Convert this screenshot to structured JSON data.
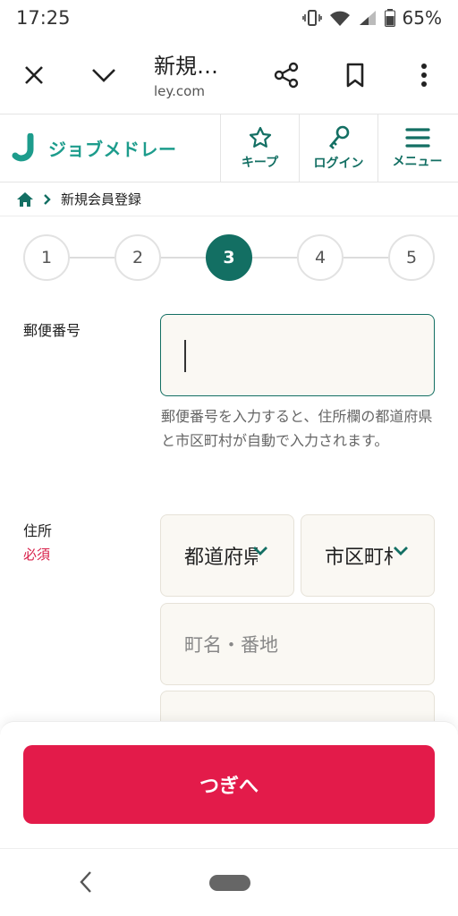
{
  "status_bar": {
    "time": "17:25",
    "battery": "65%"
  },
  "browser": {
    "title": "新規…",
    "url": "ley.com"
  },
  "site": {
    "logo_text": "ジョブメドレー",
    "buttons": [
      {
        "label": "キープ",
        "icon": "star-icon"
      },
      {
        "label": "ログイン",
        "icon": "key-icon"
      },
      {
        "label": "メニュー",
        "icon": "menu-icon"
      }
    ]
  },
  "breadcrumb": {
    "current": "新規会員登録"
  },
  "stepper": {
    "steps": [
      "1",
      "2",
      "3",
      "4",
      "5"
    ],
    "active_step": 3
  },
  "form": {
    "postal": {
      "label": "郵便番号",
      "value": "",
      "help": "郵便番号を入力すると、住所欄の都道府県と市区町村が自動で入力されます。"
    },
    "address": {
      "label": "住所",
      "required": "必須",
      "prefecture": "都道府県",
      "city": "市区町村",
      "street_placeholder": "町名・番地"
    }
  },
  "cta": {
    "next_label": "つぎへ"
  },
  "colors": {
    "primary": "#136f63",
    "accent": "#e31b4a",
    "logo": "#1d9c8c",
    "required": "#d8204a"
  }
}
